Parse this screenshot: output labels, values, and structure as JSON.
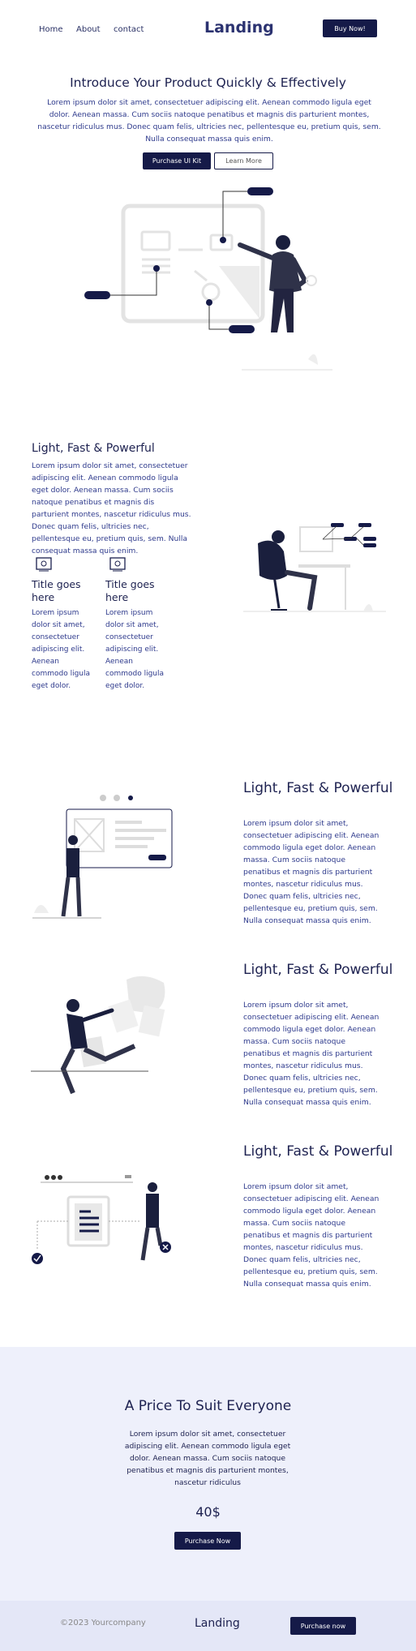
{
  "nav": {
    "links": [
      "Home",
      "About",
      "contact"
    ],
    "brand": "Landing",
    "cta": "Buy Now!"
  },
  "hero": {
    "title": "Introduce Your Product Quickly & Effectively",
    "text": "Lorem ipsum dolor sit amet, consectetuer adipiscing elit. Aenean commodo ligula eget dolor. Aenean massa. Cum sociis natoque penatibus et magnis dis parturient montes, nascetur ridiculus mus. Donec quam felis, ultricies nec, pellentesque eu, pretium quis, sem. Nulla consequat massa quis enim.",
    "primary_button": "Purchase UI Kit",
    "secondary_button": "Learn More"
  },
  "features_intro": {
    "title": "Light, Fast & Powerful",
    "text": "Lorem ipsum dolor sit amet, consectetuer adipiscing elit. Aenean commodo ligula eget dolor. Aenean massa. Cum sociis natoque penatibus et magnis dis parturient montes, nascetur ridiculus mus. Donec quam felis, ultricies nec, pellentesque eu, pretium quis, sem. Nulla consequat massa quis enim.",
    "items": [
      {
        "title": "Title goes here",
        "text": "Lorem ipsum dolor sit amet, consectetuer adipiscing elit. Aenean commodo ligula eget dolor."
      },
      {
        "title": "Title goes here",
        "text": "Lorem ipsum dolor sit amet, consectetuer adipiscing elit. Aenean commodo ligula eget dolor."
      }
    ]
  },
  "sections": [
    {
      "title": "Light, Fast & Powerful",
      "text": "Lorem ipsum dolor sit amet, consectetuer adipiscing elit. Aenean commodo ligula eget dolor. Aenean massa. Cum sociis natoque penatibus et magnis dis parturient montes, nascetur ridiculus mus. Donec quam felis, ultricies nec, pellentesque eu, pretium quis, sem. Nulla consequat massa quis enim."
    },
    {
      "title": "Light, Fast & Powerful",
      "text": "Lorem ipsum dolor sit amet, consectetuer adipiscing elit. Aenean commodo ligula eget dolor. Aenean massa. Cum sociis natoque penatibus et magnis dis parturient montes, nascetur ridiculus mus. Donec quam felis, ultricies nec, pellentesque eu, pretium quis, sem. Nulla consequat massa quis enim."
    },
    {
      "title": "Light, Fast & Powerful",
      "text": "Lorem ipsum dolor sit amet, consectetuer adipiscing elit. Aenean commodo ligula eget dolor. Aenean massa. Cum sociis natoque penatibus et magnis dis parturient montes, nascetur ridiculus mus. Donec quam felis, ultricies nec, pellentesque eu, pretium quis, sem. Nulla consequat massa quis enim."
    }
  ],
  "pricing": {
    "title": "A Price To Suit Everyone",
    "text": "Lorem ipsum dolor sit amet, consectetuer adipiscing elit. Aenean commodo ligula eget dolor. Aenean massa. Cum sociis natoque penatibus et magnis dis parturient montes, nascetur ridiculus",
    "price": "40$",
    "button": "Purchase Now"
  },
  "footer": {
    "copyright": "©2023 Yourcompany",
    "brand": "Landing",
    "button": "Purchase now"
  },
  "colors": {
    "primary": "#151a48",
    "text_blue": "#2e3a8c",
    "pricing_bg": "#eef0fb",
    "footer_bg": "#e4e7f7"
  }
}
